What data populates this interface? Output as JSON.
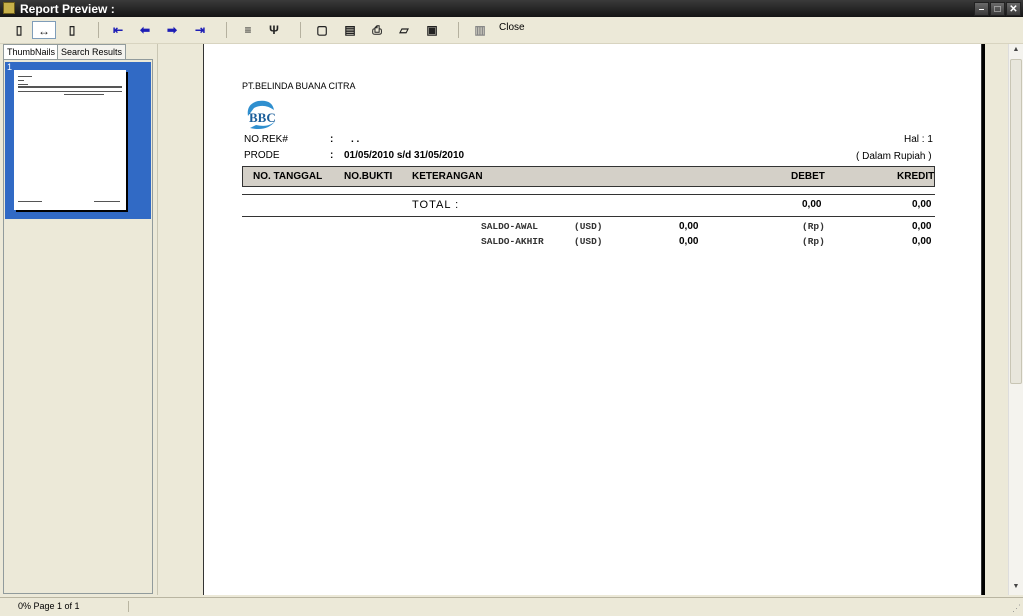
{
  "window": {
    "title": "Report Preview :"
  },
  "toolbar": {
    "close_label": "Close"
  },
  "tabs": [
    {
      "label": "ThumbNails"
    },
    {
      "label": "Search Results"
    }
  ],
  "thumbnail": {
    "number": "1"
  },
  "report": {
    "company": "PT.BELINDA BUANA CITRA",
    "logo_text": "BBC",
    "norek_label": "NO.REK#",
    "norek_value": ". .",
    "prode_label": "PRODE",
    "prode_value": "01/05/2010 s/d 31/05/2010",
    "colon": ":",
    "page_label": "Hal : 1",
    "currency_note": "( Dalam Rupiah )",
    "columns": {
      "no_tanggal": "NO. TANGGAL",
      "no_bukti": "NO.BUKTI",
      "keterangan": "KETERANGAN",
      "debet": "DEBET",
      "kredit": "KREDIT"
    },
    "total": {
      "label": "TOTAL :",
      "debet": "0,00",
      "kredit": "0,00"
    },
    "saldo_awal": {
      "label": "SALDO-AWAL",
      "cur1": "(USD)",
      "val1": "0,00",
      "cur2": "(Rp)",
      "val2": "0,00"
    },
    "saldo_akhir": {
      "label": "SALDO-AKHIR",
      "cur1": "(USD)",
      "val1": "0,00",
      "cur2": "(Rp)",
      "val2": "0,00"
    }
  },
  "status": {
    "text": "0% Page 1 of 1"
  }
}
